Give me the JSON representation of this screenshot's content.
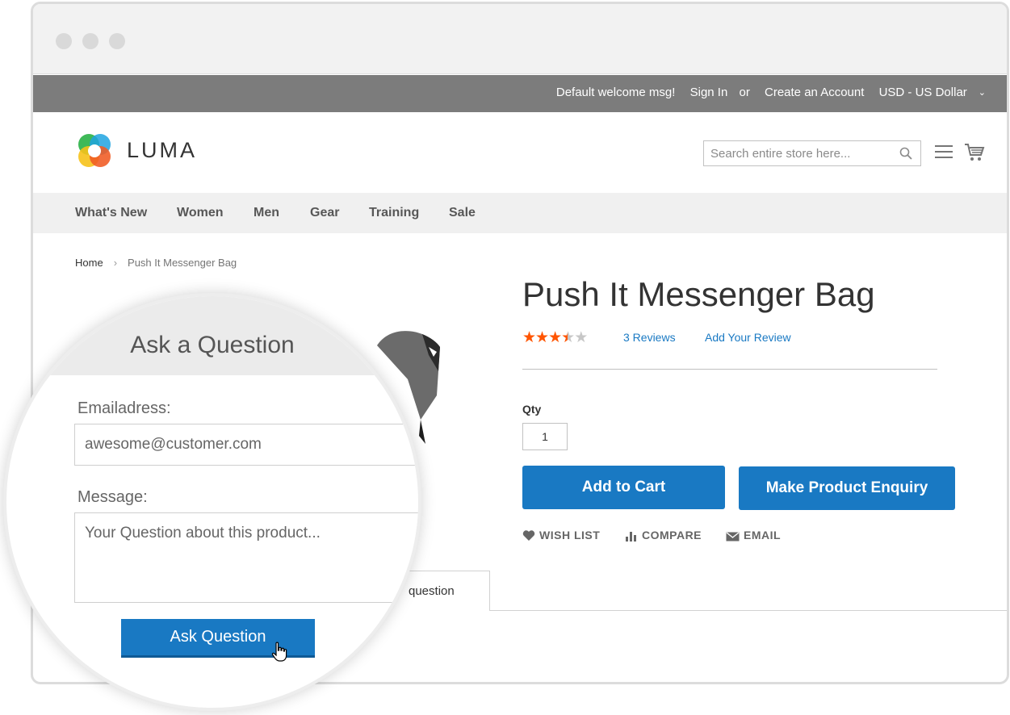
{
  "browser": {
    "dots": [
      "close",
      "minimize",
      "maximize"
    ]
  },
  "panel": {
    "welcome": "Default welcome msg!",
    "sign_in": "Sign In",
    "or": "or",
    "create_account": "Create an Account",
    "currency": "USD - US Dollar",
    "background": "#7c7c7c"
  },
  "header": {
    "logo_text": "LUMA",
    "search_placeholder": "Search entire store here...",
    "icons": [
      "search-icon",
      "menu-icon",
      "cart-icon"
    ]
  },
  "nav": {
    "items": [
      "What's New",
      "Women",
      "Men",
      "Gear",
      "Training",
      "Sale"
    ]
  },
  "breadcrumb": {
    "home": "Home",
    "current": "Push It Messenger Bag"
  },
  "product": {
    "title": "Push It Messenger Bag",
    "rating_stars_filled": 3.5,
    "rating_stars_total": 5,
    "reviews_link": "3 Reviews",
    "add_review_link": "Add Your Review",
    "qty_label": "Qty",
    "qty_value": "1",
    "add_to_cart": "Add to Cart",
    "enquiry_button": "Make Product Enquiry",
    "actions": {
      "wishlist": "WISH LIST",
      "compare": "COMPARE",
      "email": "EMAIL"
    },
    "tab_label": "question"
  },
  "ask_question": {
    "heading": "Ask a Question",
    "email_label": "Emailadress:",
    "email_value": "awesome@customer.com",
    "message_label": "Message:",
    "message_placeholder": "Your Question about this product...",
    "submit": "Ask Question"
  },
  "colors": {
    "primary_blue": "#1979c3",
    "star_orange": "#ff5501",
    "link_blue": "#1979c3"
  }
}
